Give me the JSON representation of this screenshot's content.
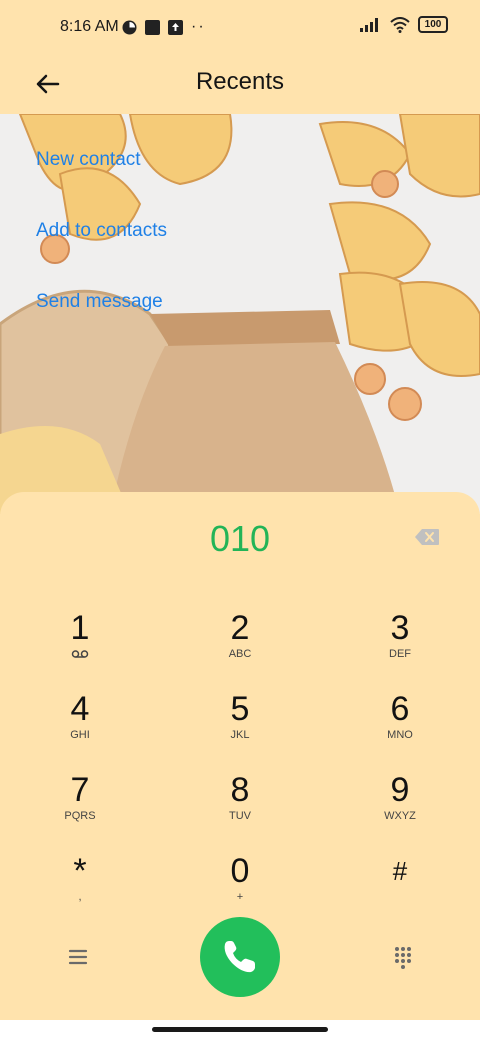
{
  "status_bar": {
    "time": "8:16 AM",
    "battery": "100"
  },
  "header": {
    "title": "Recents"
  },
  "actions": [
    "New contact",
    "Add to contacts",
    "Send message"
  ],
  "dialer": {
    "number": "010",
    "keys": [
      {
        "digit": "1",
        "letters": ""
      },
      {
        "digit": "2",
        "letters": "ABC"
      },
      {
        "digit": "3",
        "letters": "DEF"
      },
      {
        "digit": "4",
        "letters": "GHI"
      },
      {
        "digit": "5",
        "letters": "JKL"
      },
      {
        "digit": "6",
        "letters": "MNO"
      },
      {
        "digit": "7",
        "letters": "PQRS"
      },
      {
        "digit": "8",
        "letters": "TUV"
      },
      {
        "digit": "9",
        "letters": "WXYZ"
      },
      {
        "digit": "*",
        "letters": ","
      },
      {
        "digit": "0",
        "letters": "+"
      },
      {
        "digit": "#",
        "letters": ""
      }
    ]
  },
  "colors": {
    "accent_green": "#22bf5b",
    "link_blue": "#1f80e6",
    "background": "#ffe3ad"
  },
  "icons": {
    "back": "arrow-left-icon",
    "backspace": "backspace-icon",
    "menu": "menu-icon",
    "call": "phone-icon",
    "keypad": "keypad-icon",
    "voicemail": "voicemail-icon"
  }
}
